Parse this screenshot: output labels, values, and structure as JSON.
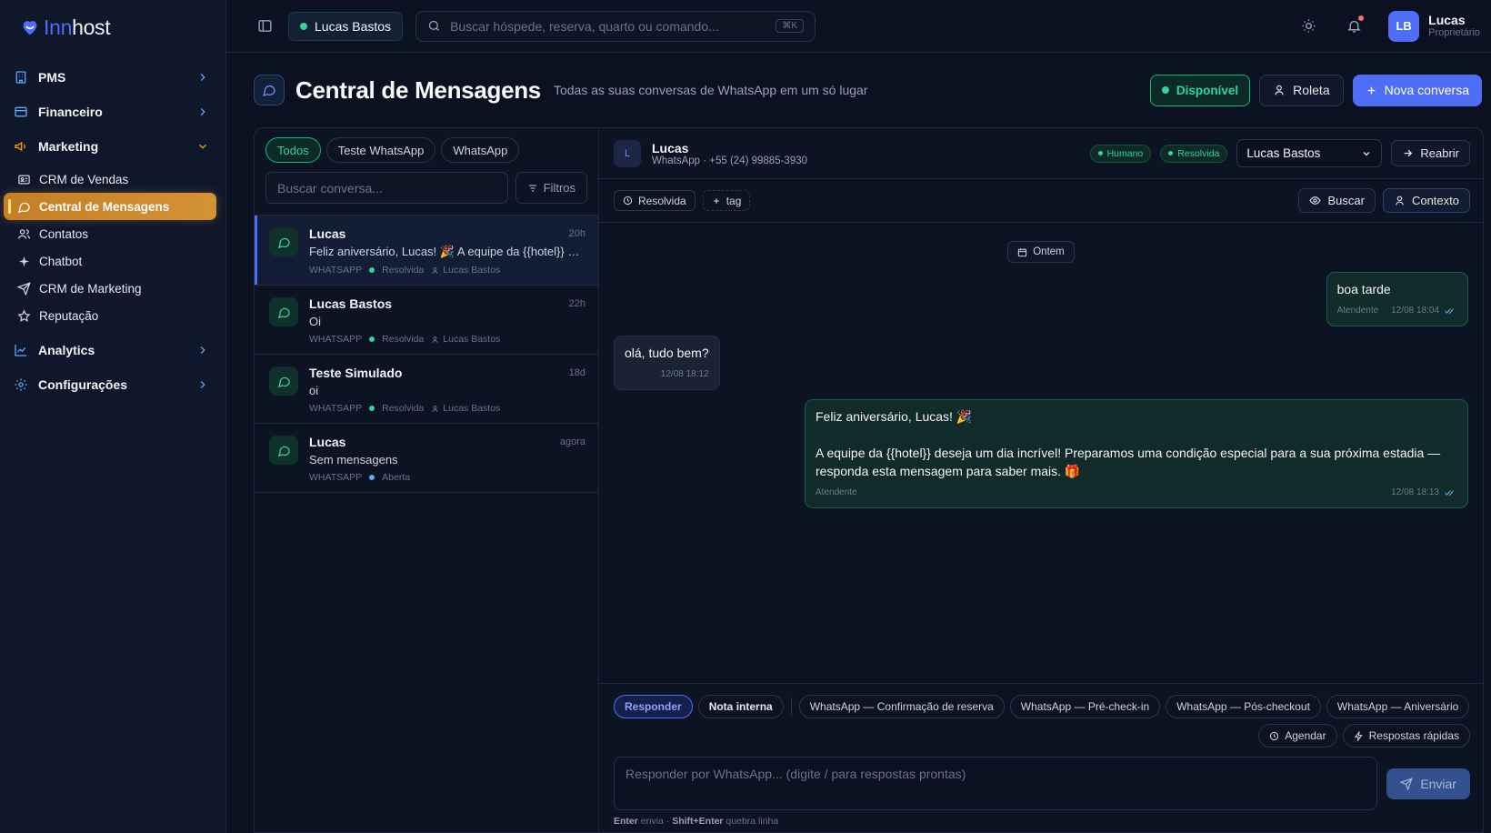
{
  "brand": {
    "part1": "Inn",
    "part2": "host"
  },
  "sidebar": {
    "groups": [
      {
        "label": "PMS"
      },
      {
        "label": "Financeiro"
      },
      {
        "label": "Marketing"
      },
      {
        "label": "Analytics"
      },
      {
        "label": "Configurações"
      }
    ],
    "marketing_items": [
      {
        "label": "CRM de Vendas"
      },
      {
        "label": "Central de Mensagens"
      },
      {
        "label": "Contatos"
      },
      {
        "label": "Chatbot"
      },
      {
        "label": "CRM de Marketing"
      },
      {
        "label": "Reputação"
      }
    ]
  },
  "topbar": {
    "active_user": "Lucas Bastos",
    "search_placeholder": "Buscar hóspede, reserva, quarto ou comando...",
    "search_shortcut": "⌘K",
    "user_initials": "LB",
    "user_name": "Lucas",
    "user_role": "Proprietário"
  },
  "page": {
    "title": "Central de Mensagens",
    "subtitle": "Todas as suas conversas de WhatsApp em um só lugar",
    "status_button": "Disponível",
    "roulette_button": "Roleta",
    "new_button": "Nova conversa"
  },
  "conversations": {
    "tabs": [
      "Todos",
      "Teste WhatsApp",
      "WhatsApp"
    ],
    "search_placeholder": "Buscar conversa...",
    "filter_label": "Filtros",
    "items": [
      {
        "name": "Lucas",
        "time": "20h",
        "message": "Feliz aniversário, Lucas! 🎉 A equipe da {{hotel}} deseja um dia incrível!",
        "channel": "WHATSAPP",
        "status": "Resolvida",
        "agent": "Lucas Bastos"
      },
      {
        "name": "Lucas Bastos",
        "time": "22h",
        "message": "Oi",
        "channel": "WHATSAPP",
        "status": "Resolvida",
        "agent": "Lucas Bastos"
      },
      {
        "name": "Teste Simulado",
        "time": "18d",
        "message": "oi",
        "channel": "WHATSAPP",
        "status": "Resolvida",
        "agent": "Lucas Bastos"
      },
      {
        "name": "Lucas",
        "time": "agora",
        "message": "Sem mensagens",
        "channel": "WHATSAPP",
        "status": "Aberta",
        "agent": ""
      }
    ]
  },
  "chat": {
    "avatar": "L",
    "name": "Lucas",
    "subtitle": "WhatsApp · +55 (24) 99885-3930",
    "badge_human": "Humano",
    "badge_status": "Resolvida",
    "assignee": "Lucas Bastos",
    "reopen_button": "Reabrir",
    "tag_status": "Resolvida",
    "tag_add": "tag",
    "search_button": "Buscar",
    "context_button": "Contexto",
    "day_label": "Ontem",
    "messages": [
      {
        "text": "boa tarde",
        "author": "Atendente",
        "time": "12/08 18:04"
      },
      {
        "text": "olá, tudo bem?",
        "time": "12/08 18:12"
      },
      {
        "line1": "Feliz aniversário, Lucas! 🎉",
        "line2": "A equipe da {{hotel}} deseja um dia incrível! Preparamos uma condição especial para a sua próxima estadia — responda esta mensagem para saber mais. 🎁",
        "author": "Atendente",
        "time": "12/08 18:13"
      }
    ]
  },
  "composer": {
    "mode_reply": "Responder",
    "mode_note": "Nota interna",
    "templates": [
      "WhatsApp — Confirmação de reserva",
      "WhatsApp — Pré-check-in",
      "WhatsApp — Pós-checkout",
      "WhatsApp — Aniversário"
    ],
    "schedule_button": "Agendar",
    "quick_button": "Respostas rápidas",
    "placeholder": "Responder por WhatsApp...  (digite / para respostas prontas)",
    "send_button": "Enviar",
    "hint_key1": "Enter",
    "hint_text1": " envia · ",
    "hint_key2": "Shift+Enter",
    "hint_text2": " quebra linha"
  },
  "colors": {
    "accent": "#4f6ef7",
    "active_nav": "#c67f22",
    "success": "#34d399",
    "background": "#0b1120"
  }
}
